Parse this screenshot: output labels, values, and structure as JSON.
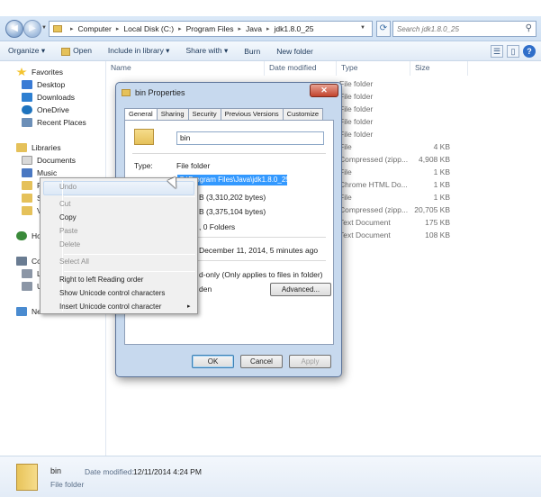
{
  "explorer": {
    "address": [
      "Computer",
      "Local Disk (C:)",
      "Program Files",
      "Java",
      "jdk1.8.0_25"
    ],
    "search_placeholder": "Search jdk1.8.0_25",
    "toolbar": {
      "organize": "Organize ▾",
      "open": "Open",
      "include": "Include in library ▾",
      "share": "Share with ▾",
      "burn": "Burn",
      "new_folder": "New folder"
    },
    "nav": {
      "favorites": "Favorites",
      "desktop": "Desktop",
      "downloads": "Downloads",
      "onedrive": "OneDrive",
      "recent": "Recent Places",
      "libraries": "Libraries",
      "documents": "Documents",
      "music": "Music",
      "partial": [
        "P",
        "S",
        "V",
        "Ho",
        "Co",
        "L",
        "U",
        "Ne"
      ]
    },
    "columns": {
      "name": "Name",
      "date": "Date modified",
      "type": "Type",
      "size": "Size"
    },
    "rows": [
      {
        "type": "File folder",
        "size": ""
      },
      {
        "type": "File folder",
        "size": ""
      },
      {
        "type": "File folder",
        "size": ""
      },
      {
        "type": "File folder",
        "size": ""
      },
      {
        "type": "File folder",
        "size": ""
      },
      {
        "type": "File",
        "size": "4 KB"
      },
      {
        "type": "Compressed (zipp...",
        "size": "4,908 KB"
      },
      {
        "type": "File",
        "size": "1 KB"
      },
      {
        "type": "Chrome HTML Do...",
        "size": "1 KB"
      },
      {
        "type": "File",
        "size": "1 KB"
      },
      {
        "type": "Compressed (zipp...",
        "size": "20,705 KB"
      },
      {
        "type": "Text Document",
        "size": "175 KB"
      },
      {
        "type": "Text Document",
        "size": "108 KB"
      }
    ],
    "status": {
      "name": "bin",
      "type": "File folder",
      "date_label": "Date modified:",
      "date_value": "12/11/2014 4:24 PM"
    }
  },
  "dialog": {
    "title": "bin Properties",
    "close": "✕",
    "tabs": [
      "General",
      "Sharing",
      "Security",
      "Previous Versions",
      "Customize"
    ],
    "folder_name": "bin",
    "type_label": "Type:",
    "type_value": "File folder",
    "location_selected": "C:\\Program Files\\Java\\jdk1.8.0_25",
    "size_value": "B (3,310,202 bytes)",
    "size_on_disk_value": "B (3,375,104 bytes)",
    "contains_value": ", 0 Folders",
    "created_value": "December 11, 2014, 5 minutes ago",
    "readonly_value": "d-only (Only applies to files in folder)",
    "hidden_value": "den",
    "advanced": "Advanced...",
    "ok": "OK",
    "cancel": "Cancel",
    "apply": "Apply"
  },
  "context_menu": {
    "items": [
      {
        "label": "Undo",
        "enabled": false
      },
      {
        "label": "Cut",
        "enabled": false
      },
      {
        "label": "Copy",
        "enabled": true
      },
      {
        "label": "Paste",
        "enabled": false
      },
      {
        "label": "Delete",
        "enabled": false
      },
      {
        "label": "Select All",
        "enabled": false
      },
      {
        "label": "Right to left Reading order",
        "enabled": true
      },
      {
        "label": "Show Unicode control characters",
        "enabled": true
      },
      {
        "label": "Insert Unicode control character",
        "enabled": true
      }
    ],
    "submenu_arrow": "▸"
  },
  "colors": {
    "selection": "#3399ff",
    "titlebar": "#c7d9ee",
    "close_button": "#c2432c"
  }
}
